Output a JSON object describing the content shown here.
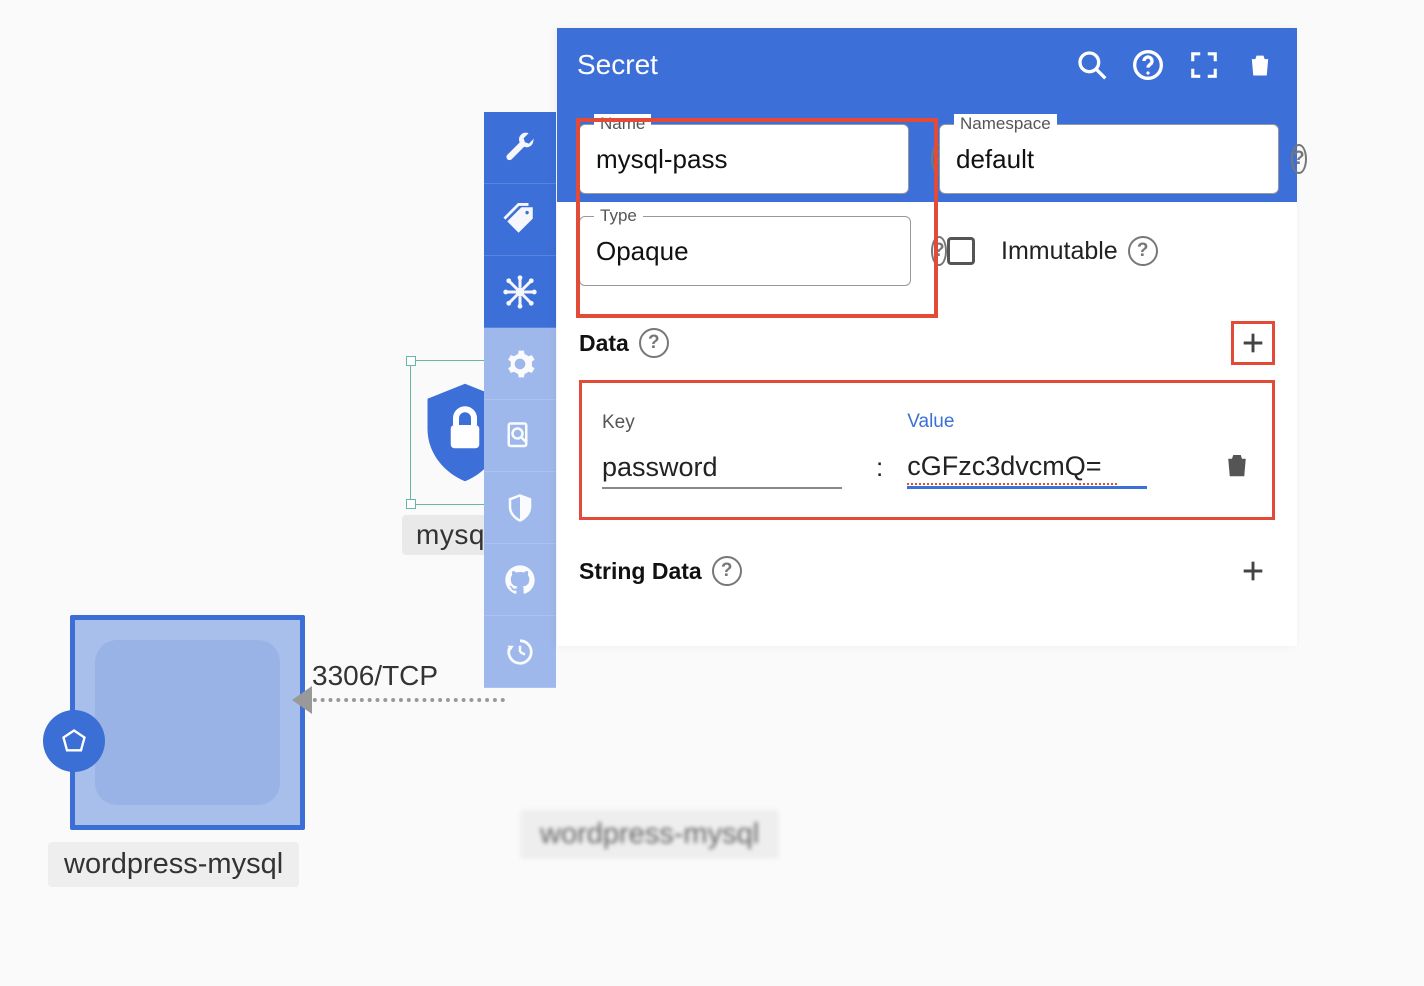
{
  "panel": {
    "title": "Secret",
    "name_field": {
      "label": "Name",
      "value": "mysql-pass"
    },
    "namespace_field": {
      "label": "Namespace",
      "value": "default"
    },
    "type_field": {
      "label": "Type",
      "value": "Opaque"
    },
    "immutable_label": "Immutable",
    "sections": {
      "data": {
        "title": "Data",
        "rows": [
          {
            "key_label": "Key",
            "key": "password",
            "value_label": "Value",
            "value": "cGFzc3dvcmQ="
          }
        ]
      },
      "string_data": {
        "title": "String Data"
      }
    }
  },
  "canvas": {
    "secret_node_label": "mysql",
    "wp_mysql_label": "wordpress-mysql",
    "wp_mysql2_label": "wordpress-mysql",
    "connection_label": "3306/TCP"
  },
  "vtoolbar_icons": [
    "wrench",
    "tags",
    "graph",
    "gear",
    "zoom-doc",
    "shield-half",
    "github",
    "history"
  ]
}
